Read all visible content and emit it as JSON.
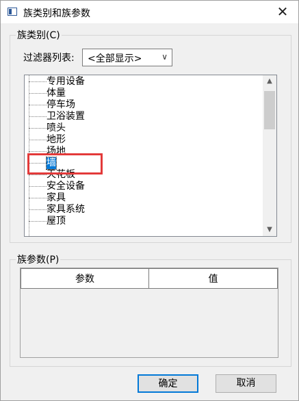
{
  "window": {
    "title": "族类别和族参数",
    "close_symbol": "✕"
  },
  "category_group": {
    "label": "族类别(C)",
    "filter_label": "过滤器列表:",
    "filter_value": "<全部显示>",
    "items": [
      {
        "label": "专用设备"
      },
      {
        "label": "体量"
      },
      {
        "label": "停车场"
      },
      {
        "label": "卫浴装置"
      },
      {
        "label": "喷头"
      },
      {
        "label": "地形"
      },
      {
        "label": "场地"
      },
      {
        "label": "墙",
        "selected": true
      },
      {
        "label": "天花板"
      },
      {
        "label": "安全设备"
      },
      {
        "label": "家具"
      },
      {
        "label": "家具系统"
      },
      {
        "label": "屋顶"
      }
    ]
  },
  "params_group": {
    "label": "族参数(P)",
    "columns": [
      "参数",
      "值"
    ]
  },
  "buttons": {
    "ok": "确定",
    "cancel": "取消"
  },
  "colors": {
    "selection": "#0078d7",
    "highlight_border": "#e33a3a"
  }
}
